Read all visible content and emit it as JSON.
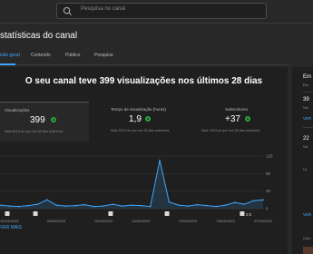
{
  "header": {
    "search_placeholder": "Pesquisa no canal"
  },
  "page_title": "statísticas do canal",
  "tabs": [
    {
      "label": "isão geral",
      "active": true
    },
    {
      "label": "Conteúdo",
      "active": false
    },
    {
      "label": "Público",
      "active": false
    },
    {
      "label": "Pesquisa",
      "active": false
    }
  ],
  "headline": "O seu canal teve 399 visualizações nos últimos 28 dias",
  "metrics": [
    {
      "label": "Visualizações",
      "value": "399",
      "sub": "Mais 604% do que nos 28 dias anteriores",
      "selected": true
    },
    {
      "label": "Tempo de visualização (horas)",
      "value": "1,9",
      "sub": "Mais 232% do que nos 28 dias anteriores",
      "selected": false
    },
    {
      "label": "Subscritores",
      "value": "+37",
      "sub": "Mais +99% do que nos 28 dias anteriores",
      "selected": false
    }
  ],
  "colors": {
    "accent": "#3ea6ff",
    "positive": "#2ba640",
    "background": "#1f1f1f"
  },
  "chart_data": {
    "type": "area",
    "x": [
      "30/03/2023",
      "31/03/2023",
      "01/04/2023",
      "02/04/2023",
      "03/04/2023",
      "04/04/2023",
      "05/04/2023",
      "06/04/2023",
      "07/04/2023",
      "08/04/2023",
      "09/04/2023",
      "10/04/2023",
      "11/04/2023",
      "12/04/2023",
      "13/04/2023",
      "14/04/2023",
      "15/04/2023",
      "16/04/2023",
      "17/04/2023",
      "18/04/2023",
      "19/04/2023",
      "20/04/2023",
      "21/04/2023",
      "22/04/2023",
      "23/04/2023",
      "24/04/2023",
      "25/04/2023",
      "26/04/2023",
      "27/04/2023"
    ],
    "x_tick_labels": [
      "31/03/2023",
      "05/04/2023",
      "10/04/2023",
      "14/04/2023",
      "19/04/2023",
      "23/04/2023",
      "27/04/2023"
    ],
    "series": [
      {
        "values": [
          8,
          6,
          5,
          7,
          10,
          20,
          8,
          6,
          7,
          9,
          5,
          6,
          10,
          6,
          8,
          7,
          5,
          110,
          15,
          8,
          6,
          9,
          7,
          5,
          8,
          14,
          10,
          18,
          20
        ]
      }
    ],
    "yticks": [
      0,
      40,
      80,
      120
    ],
    "ylim": [
      0,
      120
    ],
    "grid": true,
    "marker_labels": [
      "2:0"
    ]
  },
  "footer_link": "VER MAIS",
  "sidebar": {
    "title_partial": "Em",
    "rows": [
      {
        "big": "39",
        "mut": "Vis"
      },
      {
        "big": "22",
        "mut": "Vis"
      }
    ],
    "link_1": "VER",
    "link_2": "VER",
    "link_3": "VER",
    "label_com": "Com",
    "label_ul": "Ul"
  }
}
